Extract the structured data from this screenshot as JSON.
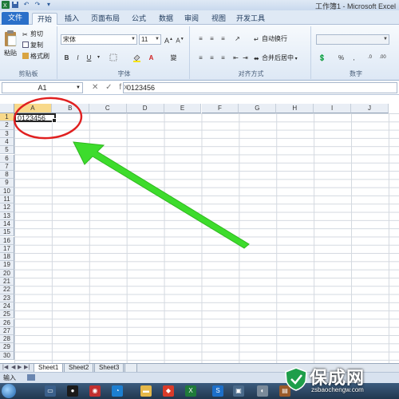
{
  "app": {
    "window_title": "工作簿1 - Microsoft Excel"
  },
  "ribbon": {
    "tabs": [
      "文件",
      "开始",
      "插入",
      "页面布局",
      "公式",
      "数据",
      "审阅",
      "视图",
      "开发工具"
    ],
    "active_tab": "开始",
    "clipboard": {
      "paste_label": "粘贴",
      "cut_label": "剪切",
      "copy_label": "复制",
      "format_painter_label": "格式刷",
      "group_label": "剪贴板"
    },
    "font": {
      "font_name": "宋体",
      "font_size": "11",
      "group_label": "字体"
    },
    "alignment": {
      "wrap_text_label": "自动换行",
      "merge_center_label": "合并后居中",
      "group_label": "对齐方式"
    },
    "number": {
      "group_label": "数字"
    }
  },
  "formula_bar": {
    "name_box": "A1",
    "icons": "✕ ✓ fx",
    "content": "0123456"
  },
  "sheet": {
    "columns": [
      "A",
      "B",
      "C",
      "D",
      "E",
      "F",
      "G",
      "H",
      "I",
      "J"
    ],
    "rows": [
      "1",
      "2",
      "3",
      "4",
      "5",
      "6",
      "7",
      "8",
      "9",
      "10",
      "11",
      "12",
      "13",
      "14",
      "15",
      "16",
      "17",
      "18",
      "19",
      "20",
      "21",
      "22",
      "23",
      "24",
      "25",
      "26",
      "27",
      "28",
      "29",
      "30"
    ],
    "selected_column": "A",
    "selected_row": "1",
    "cell_a1": "0123456",
    "tabs": [
      "Sheet1",
      "Sheet2",
      "Sheet3"
    ],
    "active_tab": "Sheet1"
  },
  "status_bar": {
    "mode": "输入"
  },
  "watermark": {
    "brand": "保成网",
    "url": "zsbaochengw.com"
  },
  "colors": {
    "annotation_circle": "#e02020",
    "annotation_arrow": "#3ddc2c",
    "file_tab": "#2a6fc9",
    "selection_header": "#f8d98b"
  }
}
